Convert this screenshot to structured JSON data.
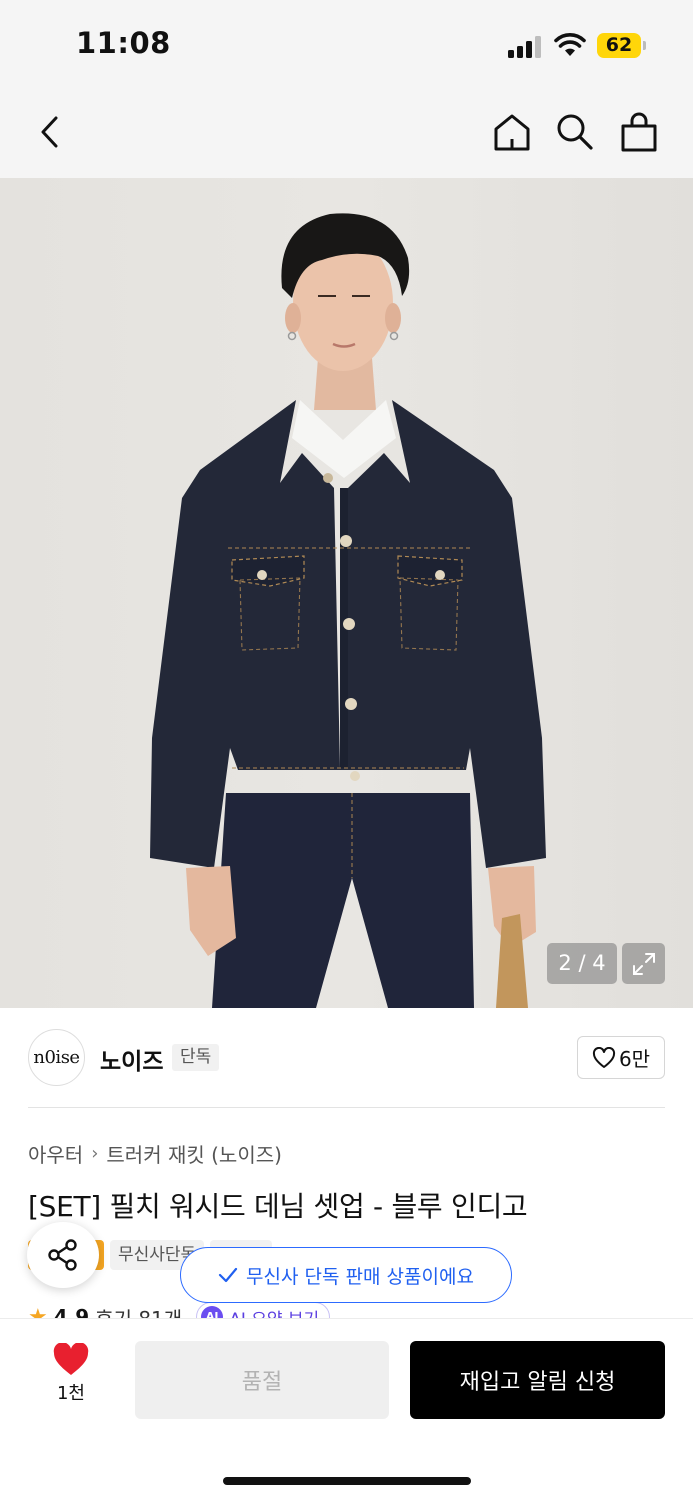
{
  "status_bar": {
    "time": "11:08",
    "battery": "62",
    "icons": [
      "signal-icon",
      "wifi-icon",
      "battery-icon"
    ]
  },
  "nav": {
    "icons": [
      "back-icon",
      "home-icon",
      "search-icon",
      "bag-icon"
    ]
  },
  "gallery": {
    "counter": "2 / 4",
    "icons": [
      "expand-icon"
    ]
  },
  "brand": {
    "logo_text": "n0ise",
    "name": "노이즈",
    "badge": "단독",
    "likes": "6만"
  },
  "breadcrumb": {
    "items": [
      "아우터",
      "트러커 재킷 (노이즈)"
    ]
  },
  "product": {
    "title": "[SET] 필치 워시드 데님 셋업 - 블루 인디고",
    "tags": [
      "무신사단독"
    ]
  },
  "toast": {
    "text": "무신사 단독 판매 상품이에요"
  },
  "rating": {
    "score": "4.9",
    "reviews": "후기 81개",
    "ai_badge": "AI",
    "ai_summary": "AI 요약 보기"
  },
  "bottom_bar": {
    "like_count": "1천",
    "soldout_label": "품절",
    "restock_label": "재입고 알림 신청"
  },
  "colors": {
    "accent_blue": "#2d6bff",
    "heart_red": "#e8202f",
    "button_black": "#000000",
    "battery_yellow": "#ffd60a"
  }
}
